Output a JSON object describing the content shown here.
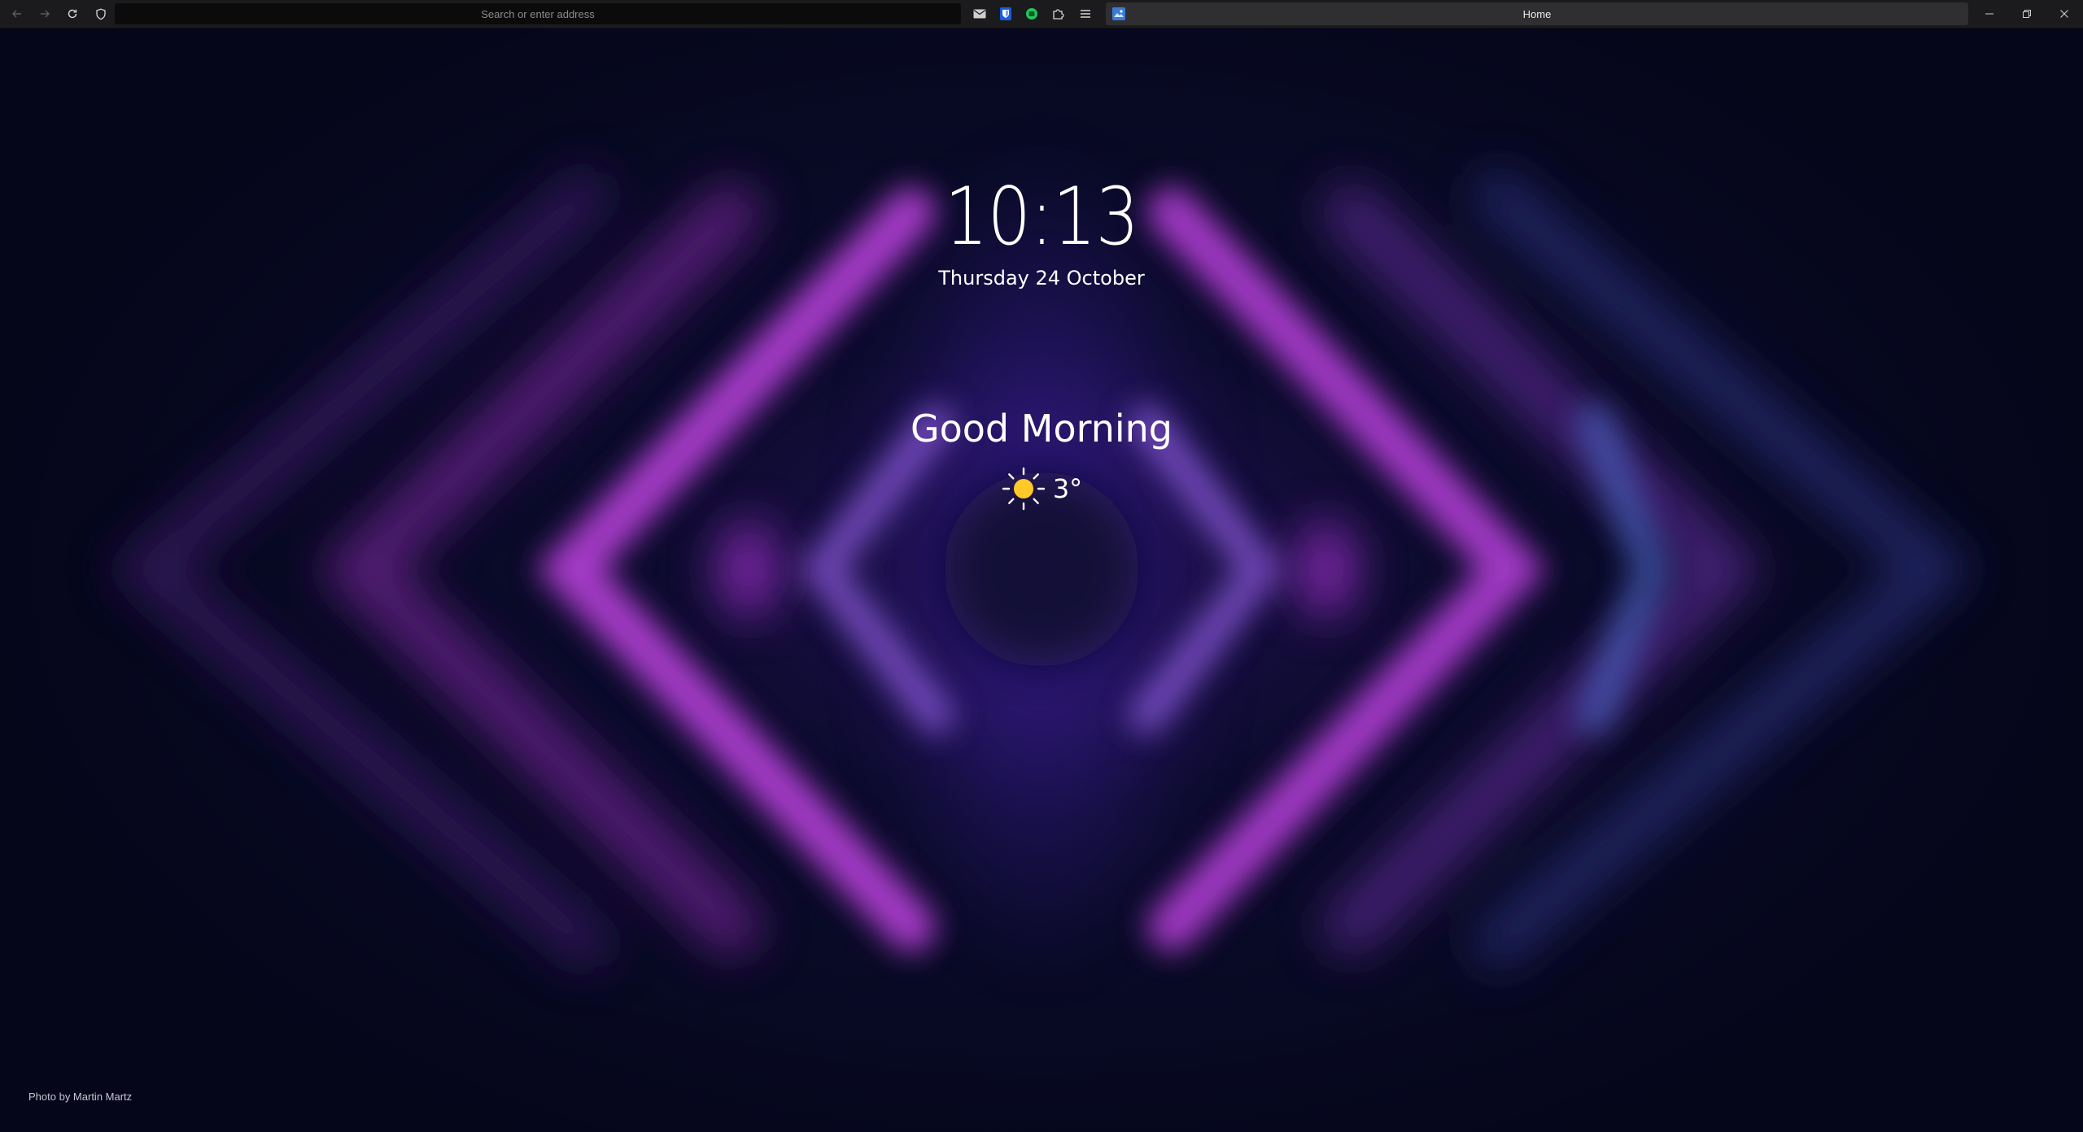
{
  "browser": {
    "address_placeholder": "Search or enter address",
    "tab_title": "Home"
  },
  "icons": {
    "back": "arrow-left-icon",
    "forward": "arrow-right-icon",
    "reload": "reload-icon",
    "shield": "shield-icon",
    "mail": "mail-icon",
    "bitwarden": "bitwarden-icon",
    "green_extension": "green-extension-icon",
    "extensions": "puzzle-icon",
    "menu": "hamburger-menu-icon",
    "weather": "sun-icon"
  },
  "newtab": {
    "time": "10:13",
    "date": "Thursday 24 October",
    "greeting": "Good Morning",
    "temperature": "3°",
    "photo_credit": "Photo by Martin Martz"
  },
  "colors": {
    "topbar": "#1b1b1d",
    "background": "#070820",
    "accent_purple": "#b43cd8",
    "accent_blue": "#5a3cff",
    "sun": "#ffc928"
  }
}
